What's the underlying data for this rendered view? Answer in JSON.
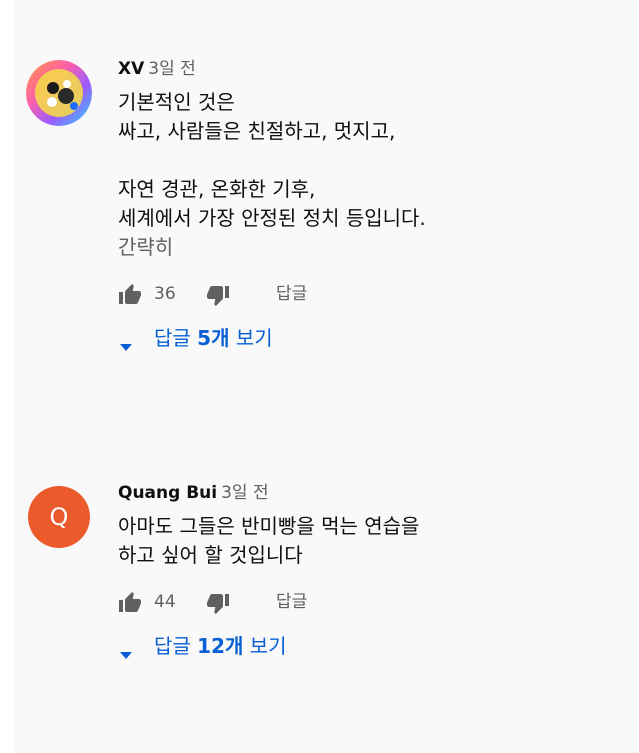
{
  "comments": [
    {
      "author": "XV",
      "time": "3일 전",
      "lines": [
        "기본적인 것은",
        "싸고, 사람들은 친절하고, 멋지고,",
        "",
        "자연 경관, 온화한 기후,",
        "세계에서 가장 안정된 정치 등입니다."
      ],
      "read_more": "간략히",
      "likes": "36",
      "reply_label": "답글",
      "replies_prefix": "답글 ",
      "replies_count": "5개",
      "replies_suffix": " 보기"
    },
    {
      "author": "Quang Bui",
      "avatar_letter": "Q",
      "time": "3일 전",
      "lines": [
        "아마도 그들은 반미빵을 먹는 연습을",
        "하고 싶어 할 것입니다"
      ],
      "likes": "44",
      "reply_label": "답글",
      "replies_prefix": "답글 ",
      "replies_count": "12개",
      "replies_suffix": " 보기"
    }
  ],
  "icons": {
    "like": "thumb-up-icon",
    "dislike": "thumb-down-icon",
    "expand": "caret-down-icon"
  },
  "colors": {
    "avatar_q": "#ea5a2b",
    "link_blue": "#065fd4",
    "secondary_text": "#606060",
    "panel_bg": "#f9f9f9"
  }
}
